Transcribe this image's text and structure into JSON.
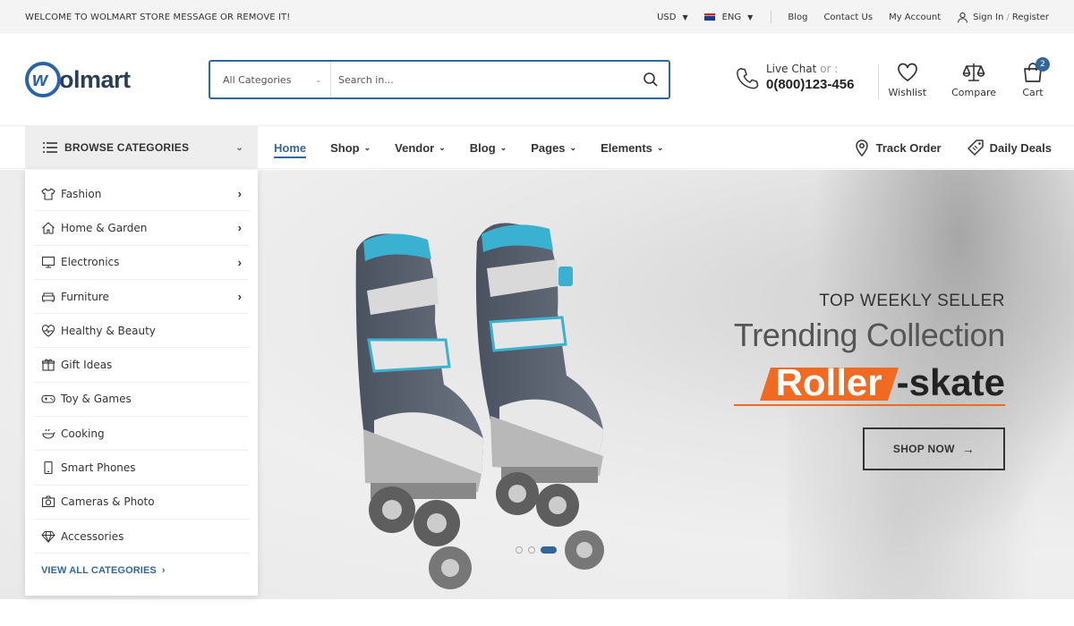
{
  "topbar": {
    "welcome": "WELCOME TO WOLMART STORE MESSAGE OR REMOVE IT!",
    "currency": "USD",
    "language": "ENG",
    "links": [
      "Blog",
      "Contact Us",
      "My Account"
    ],
    "signin": "Sign In",
    "register": "Register"
  },
  "header": {
    "logo_mark": "w",
    "logo_text": "olmart",
    "search_category": "All Categories",
    "search_placeholder": "Search in...",
    "live_chat": "Live Chat",
    "live_chat_or": "or :",
    "phone": "0(800)123-456",
    "wishlist": "Wishlist",
    "compare": "Compare",
    "cart": "Cart",
    "cart_count": "2"
  },
  "nav": {
    "browse": "BROWSE CATEGORIES",
    "items": [
      {
        "label": "Home",
        "active": true
      },
      {
        "label": "Shop"
      },
      {
        "label": "Vendor"
      },
      {
        "label": "Blog"
      },
      {
        "label": "Pages"
      },
      {
        "label": "Elements"
      }
    ],
    "track_order": "Track Order",
    "daily_deals": "Daily Deals"
  },
  "categories": {
    "items": [
      {
        "label": "Fashion",
        "icon": "tshirt-icon",
        "has_sub": true
      },
      {
        "label": "Home & Garden",
        "icon": "home-icon",
        "has_sub": true
      },
      {
        "label": "Electronics",
        "icon": "monitor-icon",
        "has_sub": true
      },
      {
        "label": "Furniture",
        "icon": "sofa-icon",
        "has_sub": true
      },
      {
        "label": "Healthy & Beauty",
        "icon": "heart-pulse-icon",
        "has_sub": false
      },
      {
        "label": "Gift Ideas",
        "icon": "gift-icon",
        "has_sub": false
      },
      {
        "label": "Toy & Games",
        "icon": "gamepad-icon",
        "has_sub": false
      },
      {
        "label": "Cooking",
        "icon": "cooking-icon",
        "has_sub": false
      },
      {
        "label": "Smart Phones",
        "icon": "phone-icon",
        "has_sub": false
      },
      {
        "label": "Cameras & Photo",
        "icon": "camera-icon",
        "has_sub": false
      },
      {
        "label": "Accessories",
        "icon": "diamond-icon",
        "has_sub": false
      }
    ],
    "view_all": "VIEW ALL CATEGORIES"
  },
  "hero": {
    "subtitle": "TOP WEEKLY SELLER",
    "title": "Trending Collection",
    "highlight": "Roller",
    "rest": "-skate",
    "button": "SHOP NOW",
    "slides": 3,
    "active_slide": 3
  },
  "colors": {
    "primary": "#336699",
    "accent": "#f16a22"
  }
}
